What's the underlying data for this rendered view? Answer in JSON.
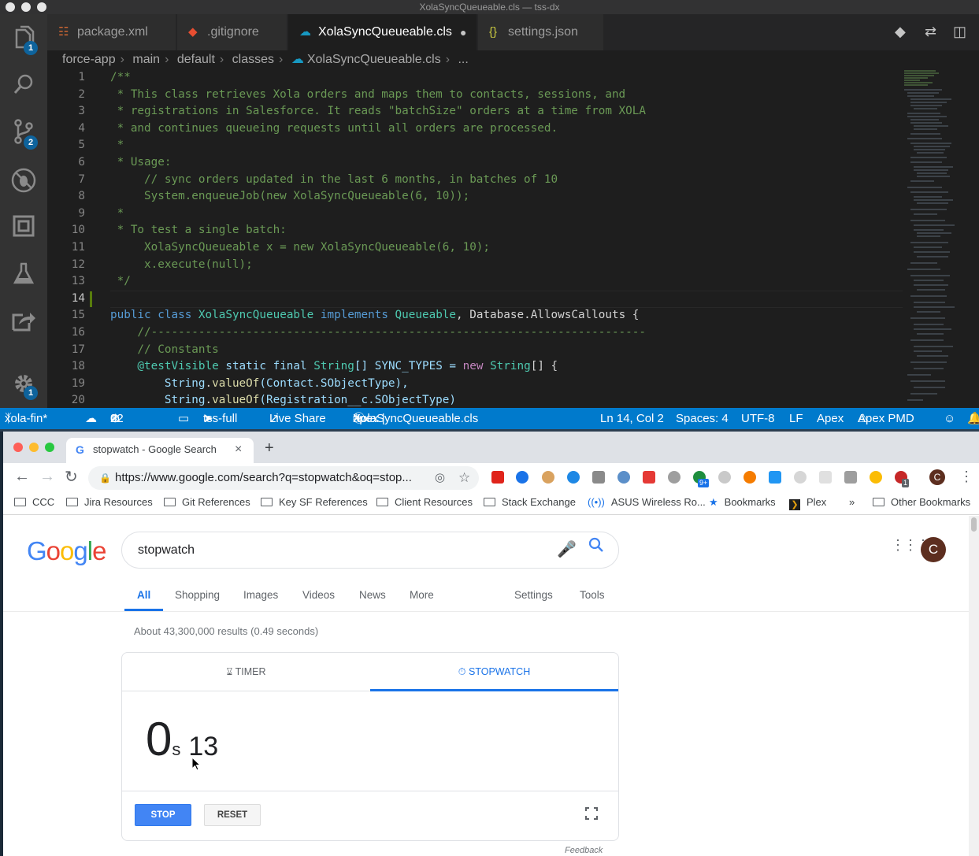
{
  "vscode": {
    "window_title": "XolaSyncQueueable.cls — tss-dx",
    "badges": {
      "explorer": "1",
      "scm": "2",
      "settings": "1"
    },
    "tabs": [
      {
        "label": "package.xml",
        "icon": "rss-icon"
      },
      {
        "label": ".gitignore",
        "icon": "git-icon"
      },
      {
        "label": "XolaSyncQueueable.cls",
        "icon": "salesforce-cloud-icon",
        "modified": true
      },
      {
        "label": "settings.json",
        "icon": "json-braces-icon"
      }
    ],
    "breadcrumbs": [
      "force-app",
      "main",
      "default",
      "classes",
      "XolaSyncQueueable.cls",
      "..."
    ],
    "line_numbers": [
      "1",
      "2",
      "3",
      "4",
      "5",
      "6",
      "7",
      "8",
      "9",
      "10",
      "11",
      "12",
      "13",
      "14",
      "15",
      "16",
      "17",
      "18",
      "19",
      "20"
    ],
    "code": {
      "l1": "/**",
      "l2": " * This class retrieves Xola orders and maps them to contacts, sessions, and",
      "l3": " * registrations in Salesforce. It reads \"batchSize\" orders at a time from XOLA",
      "l4": " * and continues queueing requests until all orders are processed.",
      "l5": " *",
      "l6": " * Usage:",
      "l7": "     // sync orders updated in the last 6 months, in batches of 10",
      "l8": "     System.enqueueJob(new XolaSyncQueueable(6, 10));",
      "l9": " *",
      "l10": " * To test a single batch:",
      "l11": "     XolaSyncQueueable x = new XolaSyncQueueable(6, 10);",
      "l12": "     x.execute(null);",
      "l13": " */",
      "l15_kw1": "public",
      "l15_kw2": "class",
      "l15_name": "XolaSyncQueueable",
      "l15_impl": "implements",
      "l15_iface": "Queueable",
      "l15_rest": ", Database.AllowsCallouts {",
      "l16": "    //-------------------------------------------------------------------------",
      "l17": "    // Constants",
      "l18_dec": "    @testVisible",
      "l18_mods": " static final ",
      "l18_type": "String",
      "l18_mid": "[] SYNC_TYPES = ",
      "l18_new": "new",
      "l18_type2": " String",
      "l18_end": "[] {",
      "l19_a": "        String",
      "l19_b": ".",
      "l19_fn": "valueOf",
      "l19_c": "(Contact.SObjectType),",
      "l20_a": "        String",
      "l20_b": ".",
      "l20_fn": "valueOf",
      "l20_c": "(Registration__c.SObjectType)"
    },
    "status": {
      "branch": "xola-fin*",
      "errors": "0",
      "warnings": "22",
      "org": "tss-full",
      "live_share": "Live Share",
      "language_scope": "apex |",
      "file": "XolaSyncQueueable.cls",
      "position": "Ln 14, Col 2",
      "spaces": "Spaces: 4",
      "encoding": "UTF-8",
      "eol": "LF",
      "language": "Apex",
      "pmd": "Apex PMD"
    }
  },
  "chrome": {
    "tab_title": "stopwatch - Google Search",
    "url": "https://www.google.com/search?q=stopwatch&oq=stop...",
    "profile_initial": "C",
    "extension_badges": {
      "green": "9+",
      "abp": "1"
    },
    "bookmarks": [
      "CCC",
      "Jira Resources",
      "Git References",
      "Key SF References",
      "Client Resources",
      "Stack Exchange",
      "ASUS Wireless Ro...",
      "Bookmarks",
      "Plex",
      "»",
      "Other Bookmarks"
    ]
  },
  "google": {
    "logo": [
      "G",
      "o",
      "o",
      "g",
      "l",
      "e"
    ],
    "logo_colors": [
      "#4285f4",
      "#ea4335",
      "#fbbc05",
      "#4285f4",
      "#34a853",
      "#ea4335"
    ],
    "query": "stopwatch",
    "nav_tabs": [
      "All",
      "Shopping",
      "Images",
      "Videos",
      "News",
      "More"
    ],
    "nav_right": [
      "Settings",
      "Tools"
    ],
    "results_info": "About 43,300,000 results (0.49 seconds)",
    "profile_initial": "C",
    "stopwatch": {
      "tabs": [
        "TIMER",
        "STOPWATCH"
      ],
      "active_tab": "STOPWATCH",
      "seconds": "0",
      "seconds_unit": "s",
      "centiseconds": "13",
      "stop_label": "STOP",
      "reset_label": "RESET"
    },
    "feedback": "Feedback"
  },
  "colors": {
    "vscode_status": "#007acc",
    "google_blue": "#1a73e8",
    "stop_button": "#4285f4"
  }
}
